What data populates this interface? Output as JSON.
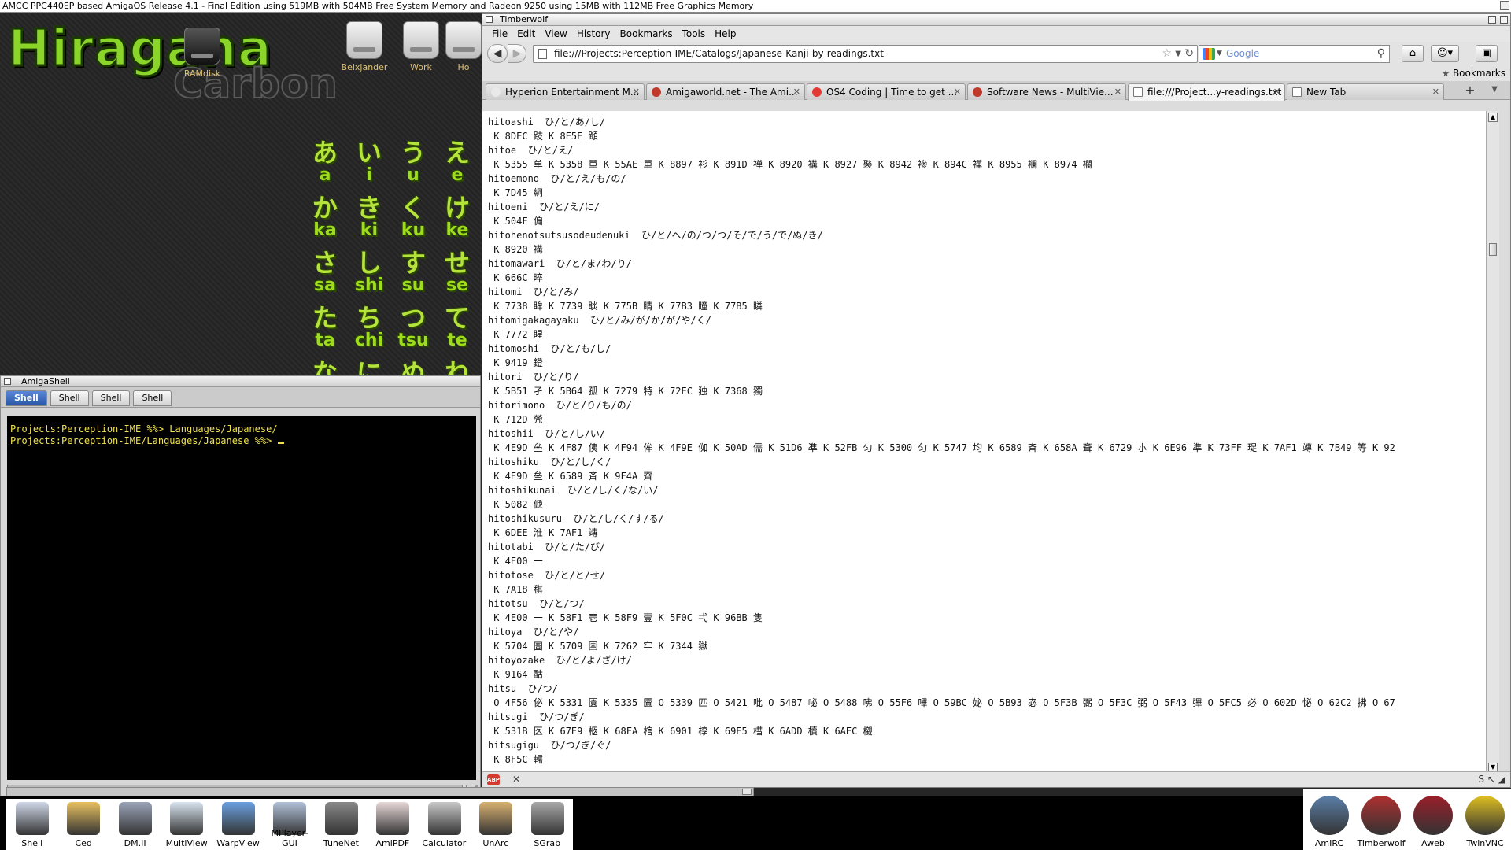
{
  "screen_title": "AMCC PPC440EP based AmigaOS Release 4.1 - Final Edition  using 519MB with 504MB Free System Memory and Radeon 9250 using 15MB with 112MB Free Graphics Memory",
  "desktop": {
    "logo_title": "Hiragana",
    "logo_sub": "Carbon",
    "icons": [
      {
        "label": "RAMdisk",
        "icon": "ramdisk-icon"
      },
      {
        "label": "Belxjander",
        "icon": "harddisk-icon"
      },
      {
        "label": "Work",
        "icon": "harddisk-icon"
      },
      {
        "label": "Ho",
        "icon": "harddisk-icon"
      }
    ],
    "kana_rows": [
      {
        "kana": [
          "あ",
          "い",
          "う",
          "え"
        ],
        "romaji": [
          "a",
          "i",
          "u",
          "e"
        ]
      },
      {
        "kana": [
          "か",
          "き",
          "く",
          "け"
        ],
        "romaji": [
          "ka",
          "ki",
          "ku",
          "ke"
        ]
      },
      {
        "kana": [
          "さ",
          "し",
          "す",
          "せ"
        ],
        "romaji": [
          "sa",
          "shi",
          "su",
          "se"
        ]
      },
      {
        "kana": [
          "た",
          "ち",
          "つ",
          "て"
        ],
        "romaji": [
          "ta",
          "chi",
          "tsu",
          "te"
        ]
      },
      {
        "kana": [
          "な",
          "に",
          "ぬ",
          "ね"
        ],
        "romaji": [
          "",
          "",
          "",
          ""
        ]
      }
    ]
  },
  "shell": {
    "title": "AmigaShell",
    "tabs": [
      "Shell",
      "Shell",
      "Shell",
      "Shell"
    ],
    "lines": [
      "Projects:Perception-IME %%> Languages/Japanese/",
      "Projects:Perception-IME/Languages/Japanese %%> "
    ]
  },
  "browser": {
    "title": "Timberwolf",
    "menu": [
      "File",
      "Edit",
      "View",
      "History",
      "Bookmarks",
      "Tools",
      "Help"
    ],
    "url": "file:///Projects:Perception-IME/Catalogs/Japanese-Kanji-by-readings.txt",
    "search_placeholder": "Google",
    "bookmarks_label": "Bookmarks",
    "tabs": [
      {
        "label": "Hyperion Entertainment M...",
        "fav": "#e9e9e9"
      },
      {
        "label": "Amigaworld.net - The Ami...",
        "fav": "#c0392b"
      },
      {
        "label": "OS4 Coding | Time to get ...",
        "fav": "#e53935"
      },
      {
        "label": "Software News - MultiVie...",
        "fav": "#c0392b"
      },
      {
        "label": "file:///Project...y-readings.txt",
        "fav": "#ffffff"
      },
      {
        "label": "New Tab",
        "fav": "#ffffff"
      }
    ],
    "content_lines": [
      "hitoashi  ひ/と/あ/し/",
      " K 8DEC 跂 K 8E5E 蹞",
      "hitoe  ひ/と/え/",
      " K 5355 单 K 5358 單 K 55AE 單 K 8897 衫 K 891D 褝 K 8920 褠 K 8927 褧 K 8942 襂 K 894C 襌 K 8955 襕 K 8974 襴",
      "hitoemono  ひ/と/え/も/の/",
      " K 7D45 絅",
      "hitoeni  ひ/と/え/に/",
      " K 504F 偏",
      "hitohenotsutsusodeudenuki  ひ/と/へ/の/つ/つ/そ/で/う/で/ぬ/き/",
      " K 8920 褠",
      "hitomawari  ひ/と/ま/わ/り/",
      " K 666C 晬",
      "hitomi  ひ/と/み/",
      " K 7738 眸 K 7739 睒 K 775B 睛 K 77B3 瞳 K 77B5 瞵",
      "hitomigakagayaku  ひ/と/み/が/か/が/や/く/",
      " K 7772 睲",
      "hitomoshi  ひ/と/も/し/",
      " K 9419 鐙",
      "hitori  ひ/と/り/",
      " K 5B51 孑 K 5B64 孤 K 7279 特 K 72EC 独 K 7368 獨",
      "hitorimono  ひ/と/り/も/の/",
      " K 712D 焭",
      "hitoshii  ひ/と/し/い/",
      " K 4E9D 亝 K 4F87 侇 K 4F94 侔 K 4F9E 侞 K 50AD 儒 K 51D6 凖 K 52FB 匀 K 5300 匀 K 5747 均 K 6589 斉 K 658A 斊 K 6729 朩 K 6E96 準 K 73FF 珿 K 7AF1 竱 K 7B49 等 K 92",
      "hitoshiku  ひ/と/し/く/",
      " K 4E9D 亝 K 6589 斉 K 9F4A 齊",
      "hitoshikunai  ひ/と/し/く/な/い/",
      " K 5082 傂",
      "hitoshikusuru  ひ/と/し/く/す/る/",
      " K 6DEE 淮 K 7AF1 竱",
      "hitotabi  ひ/と/た/び/",
      " K 4E00 一",
      "hitotose  ひ/と/と/せ/",
      " K 7A18 稘",
      "hitotsu  ひ/と/つ/",
      " K 4E00 一 K 58F1 壱 K 58F9 壹 K 5F0C 弌 K 96BB 隻",
      "hitoya  ひ/と/や/",
      " K 5704 圄 K 5709 圉 K 7262 牢 K 7344 獄",
      "hitoyozake  ひ/と/よ/ざ/け/",
      " K 9164 酤",
      "hitsu  ひ/つ/",
      " O 4F56 佖 K 5331 匱 K 5335 匵 O 5339 匹 O 5421 吡 O 5487 咇 O 5488 咈 O 55F6 嗶 O 59BC 妼 O 5B93 宓 O 5F3B 弻 O 5F3C 弼 O 5F43 彃 O 5FC5 必 O 602D 怭 O 62C2 拂 O 67",
      "hitsugi  ひ/つ/ぎ/",
      " K 531B 匛 K 67E9 柩 K 68FA 棺 K 6901 椁 K 69E5 槥 K 6ADD 櫝 K 6AEC 櫬",
      "hitsugigu  ひ/つ/ぎ/ぐ/",
      " K 8F5C 轜"
    ]
  },
  "dock": {
    "left": [
      {
        "label": "Shell",
        "icon": "shell-icon",
        "color": "#cfd8e8"
      },
      {
        "label": "Ced",
        "icon": "pencil-icon",
        "color": "#e8c060"
      },
      {
        "label": "DM.II",
        "icon": "dm-icon",
        "color": "#9aa4b8"
      },
      {
        "label": "MultiView",
        "icon": "magnifier-icon",
        "color": "#d8e4f0"
      },
      {
        "label": "WarpView",
        "icon": "eye-icon",
        "color": "#6aa0e0"
      },
      {
        "label": "MPlayer-GUI",
        "icon": "mplayer-icon",
        "color": "#b0c0d8"
      },
      {
        "label": "TuneNet",
        "icon": "speaker-icon",
        "color": "#888888"
      },
      {
        "label": "AmiPDF",
        "icon": "pdf-icon",
        "color": "#e8d8d8"
      },
      {
        "label": "Calculator",
        "icon": "calculator-icon",
        "color": "#c8c8c8"
      },
      {
        "label": "UnArc",
        "icon": "archive-icon",
        "color": "#d8b070"
      },
      {
        "label": "SGrab",
        "icon": "camera-icon",
        "color": "#a8a8a8"
      }
    ],
    "right": [
      {
        "label": "AmIRC",
        "icon": "amirc-icon",
        "color": "#5b7fa8"
      },
      {
        "label": "Timberwolf",
        "icon": "timberwolf-icon",
        "color": "#b03030"
      },
      {
        "label": "Aweb",
        "icon": "aweb-icon",
        "color": "#9a1f2a"
      },
      {
        "label": "TwinVNC",
        "icon": "twinvnc-icon",
        "color": "#e0c020"
      }
    ]
  }
}
